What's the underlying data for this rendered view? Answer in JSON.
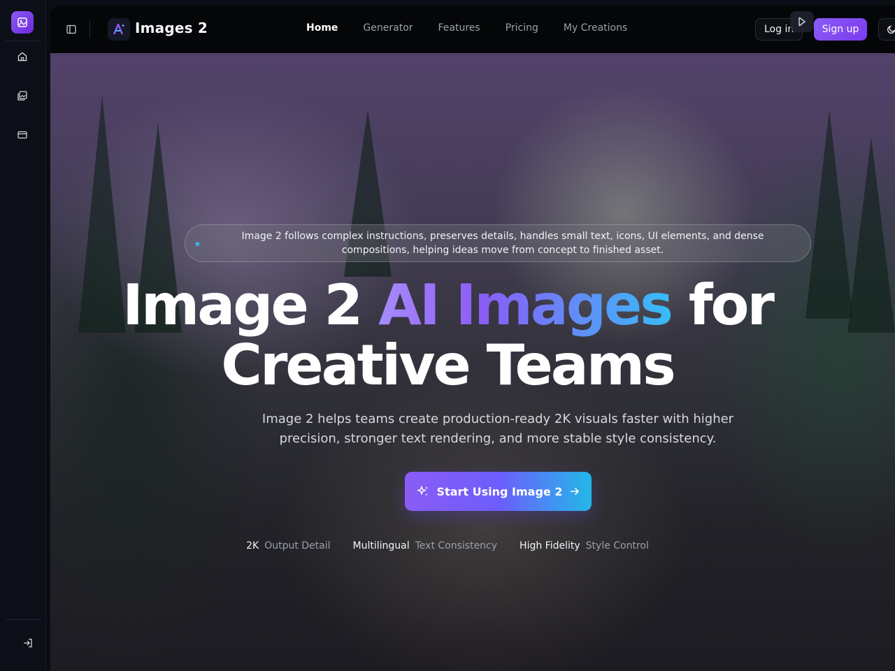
{
  "app": {
    "brand_name": "Images 2"
  },
  "rail": {
    "items": [
      "home",
      "gallery",
      "billing"
    ],
    "bottom": "sign-in"
  },
  "nav": {
    "items": [
      {
        "label": "Home",
        "active": true
      },
      {
        "label": "Generator",
        "active": false
      },
      {
        "label": "Features",
        "active": false
      },
      {
        "label": "Pricing",
        "active": false
      },
      {
        "label": "My Creations",
        "active": false
      }
    ],
    "login_label": "Log in",
    "signup_label": "Sign up"
  },
  "hero": {
    "banner": "Image 2 follows complex instructions, preserves details, handles small text, icons, UI elements, and dense compositions, helping ideas move from concept to finished asset.",
    "headline_pre": "Image 2 ",
    "headline_highlight": "AI Images",
    "headline_post_line1": " for",
    "headline_line2": "Creative Teams",
    "subheadline": "Image 2 helps teams create production-ready 2K visuals faster with higher precision, stronger text rendering, and more stable style consistency.",
    "cta_label": "Start Using Image 2",
    "stats": [
      {
        "key": "2K",
        "value": "Output Detail"
      },
      {
        "key": "Multilingual",
        "value": "Text Consistency"
      },
      {
        "key": "High Fidelity",
        "value": "Style Control"
      }
    ]
  },
  "colors": {
    "accent": "#8b5cf6",
    "accent_cyan": "#38bdf8",
    "topbar_bg": "#050608"
  }
}
